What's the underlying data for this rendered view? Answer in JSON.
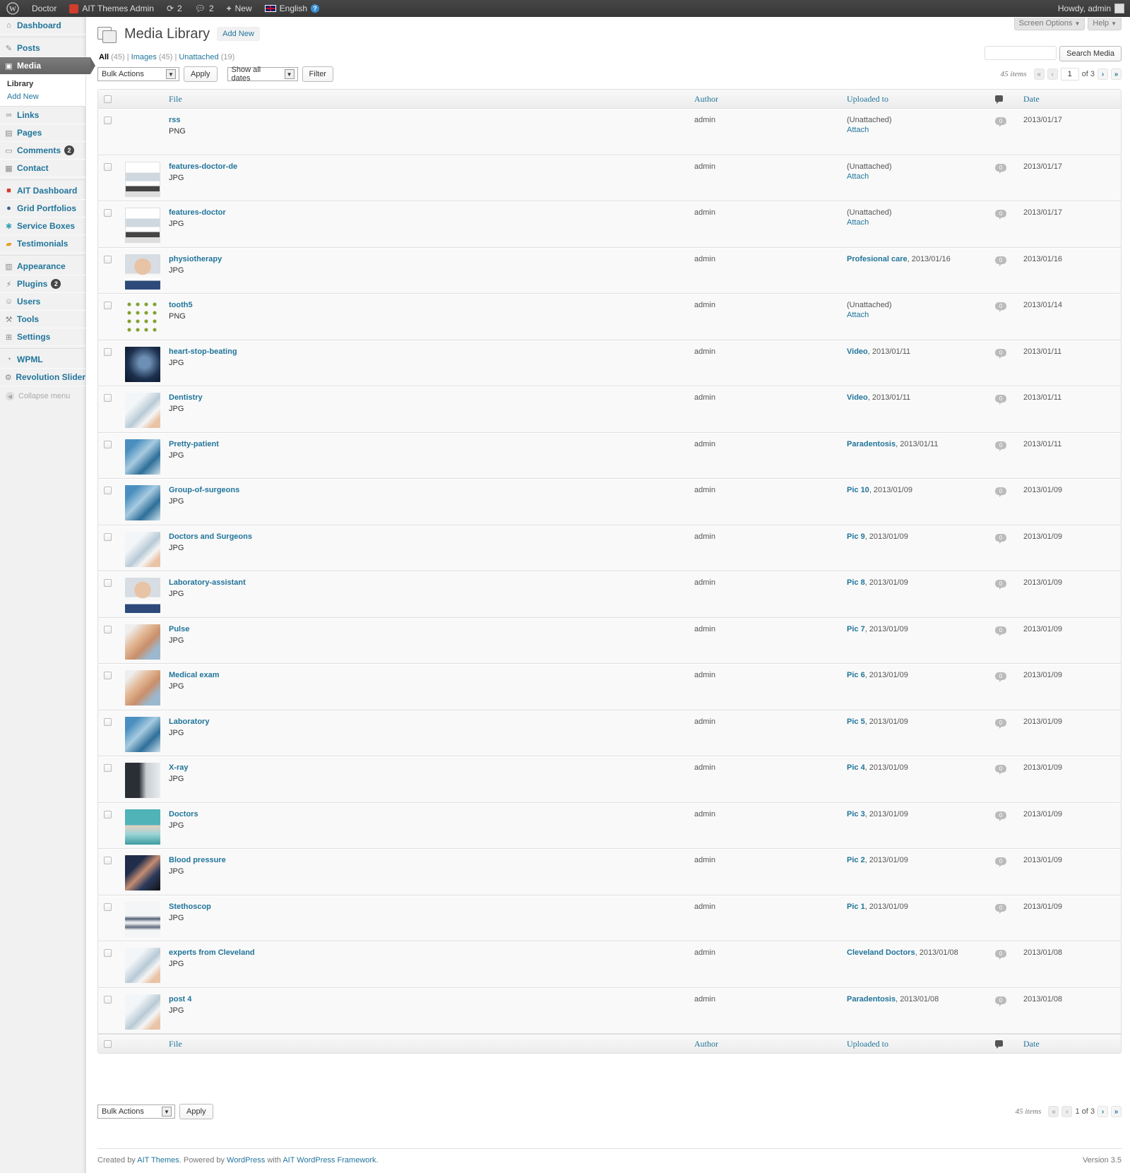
{
  "adminbar": {
    "site_name": "Doctor",
    "ait_label": "AIT Themes Admin",
    "updates_count": "2",
    "comments_count": "2",
    "new_label": "New",
    "language": "English",
    "howdy": "Howdy, admin"
  },
  "sidebar": {
    "dashboard": "Dashboard",
    "posts": "Posts",
    "media": "Media",
    "library": "Library",
    "add_new": "Add New",
    "links": "Links",
    "pages": "Pages",
    "comments": "Comments",
    "comments_badge": "2",
    "contact": "Contact",
    "ait_dashboard": "AIT Dashboard",
    "grid_portfolios": "Grid Portfolios",
    "service_boxes": "Service Boxes",
    "testimonials": "Testimonials",
    "appearance": "Appearance",
    "plugins": "Plugins",
    "plugins_badge": "2",
    "users": "Users",
    "tools": "Tools",
    "settings": "Settings",
    "wpml": "WPML",
    "revolution_slider": "Revolution Slider",
    "collapse": "Collapse menu"
  },
  "header": {
    "screen_options": "Screen Options",
    "help": "Help",
    "title": "Media Library",
    "add_new": "Add New"
  },
  "filters": {
    "all": "All",
    "all_count": "(45)",
    "images": "Images",
    "images_count": "(45)",
    "unattached": "Unattached",
    "unattached_count": "(19)",
    "sep": "|"
  },
  "search": {
    "button": "Search Media",
    "value": ""
  },
  "tablenav": {
    "bulk_actions": "Bulk Actions",
    "apply": "Apply",
    "dates": "Show all dates",
    "filter": "Filter",
    "items": "45 items",
    "current_page": "1",
    "of_pages": "of 3",
    "bottom_pages": "1 of 3"
  },
  "columns": {
    "file": "File",
    "author": "Author",
    "uploaded_to": "Uploaded to",
    "date": "Date"
  },
  "rows": [
    {
      "name": "rss",
      "type": "PNG",
      "author": "admin",
      "up_link": "",
      "up_text": "(Unattached)",
      "attach": "Attach",
      "comments": "0",
      "date": "2013/01/17",
      "thumb": "none"
    },
    {
      "name": "features-doctor-de",
      "type": "JPG",
      "author": "admin",
      "up_link": "",
      "up_text": "(Unattached)",
      "attach": "Attach",
      "comments": "0",
      "date": "2013/01/17",
      "thumb": "doc"
    },
    {
      "name": "features-doctor",
      "type": "JPG",
      "author": "admin",
      "up_link": "",
      "up_text": "(Unattached)",
      "attach": "Attach",
      "comments": "0",
      "date": "2013/01/17",
      "thumb": "doc"
    },
    {
      "name": "physiotherapy",
      "type": "JPG",
      "author": "admin",
      "up_link": "Profesional care",
      "up_text": ", 2013/01/16",
      "attach": "",
      "comments": "0",
      "date": "2013/01/16",
      "thumb": "face"
    },
    {
      "name": "tooth5",
      "type": "PNG",
      "author": "admin",
      "up_link": "",
      "up_text": "(Unattached)",
      "attach": "Attach",
      "comments": "0",
      "date": "2013/01/14",
      "thumb": "dots"
    },
    {
      "name": "heart-stop-beating",
      "type": "JPG",
      "author": "admin",
      "up_link": "Video",
      "up_text": ", 2013/01/11",
      "attach": "",
      "comments": "0",
      "date": "2013/01/11",
      "thumb": "dark"
    },
    {
      "name": "Dentistry",
      "type": "JPG",
      "author": "admin",
      "up_link": "Video",
      "up_text": ", 2013/01/11",
      "attach": "",
      "comments": "0",
      "date": "2013/01/11",
      "thumb": "light"
    },
    {
      "name": "Pretty-patient",
      "type": "JPG",
      "author": "admin",
      "up_link": "Paradentosis",
      "up_text": ", 2013/01/11",
      "attach": "",
      "comments": "0",
      "date": "2013/01/11",
      "thumb": "blue"
    },
    {
      "name": "Group-of-surgeons",
      "type": "JPG",
      "author": "admin",
      "up_link": "Pic 10",
      "up_text": ", 2013/01/09",
      "attach": "",
      "comments": "0",
      "date": "2013/01/09",
      "thumb": "blue"
    },
    {
      "name": "Doctors and Surgeons",
      "type": "JPG",
      "author": "admin",
      "up_link": "Pic 9",
      "up_text": ", 2013/01/09",
      "attach": "",
      "comments": "0",
      "date": "2013/01/09",
      "thumb": "light"
    },
    {
      "name": "Laboratory-assistant",
      "type": "JPG",
      "author": "admin",
      "up_link": "Pic 8",
      "up_text": ", 2013/01/09",
      "attach": "",
      "comments": "0",
      "date": "2013/01/09",
      "thumb": "face"
    },
    {
      "name": "Pulse",
      "type": "JPG",
      "author": "admin",
      "up_link": "Pic 7",
      "up_text": ", 2013/01/09",
      "attach": "",
      "comments": "0",
      "date": "2013/01/09",
      "thumb": "skin"
    },
    {
      "name": "Medical exam",
      "type": "JPG",
      "author": "admin",
      "up_link": "Pic 6",
      "up_text": ", 2013/01/09",
      "attach": "",
      "comments": "0",
      "date": "2013/01/09",
      "thumb": "skin"
    },
    {
      "name": "Laboratory",
      "type": "JPG",
      "author": "admin",
      "up_link": "Pic 5",
      "up_text": ", 2013/01/09",
      "attach": "",
      "comments": "0",
      "date": "2013/01/09",
      "thumb": "blue"
    },
    {
      "name": "X-ray",
      "type": "JPG",
      "author": "admin",
      "up_link": "Pic 4",
      "up_text": ", 2013/01/09",
      "attach": "",
      "comments": "0",
      "date": "2013/01/09",
      "thumb": "gray"
    },
    {
      "name": "Doctors",
      "type": "JPG",
      "author": "admin",
      "up_link": "Pic 3",
      "up_text": ", 2013/01/09",
      "attach": "",
      "comments": "0",
      "date": "2013/01/09",
      "thumb": "teal"
    },
    {
      "name": "Blood pressure",
      "type": "JPG",
      "author": "admin",
      "up_link": "Pic 2",
      "up_text": ", 2013/01/09",
      "attach": "",
      "comments": "0",
      "date": "2013/01/09",
      "thumb": "navy"
    },
    {
      "name": "Stethoscop",
      "type": "JPG",
      "author": "admin",
      "up_link": "Pic 1",
      "up_text": ", 2013/01/09",
      "attach": "",
      "comments": "0",
      "date": "2013/01/09",
      "thumb": "steth"
    },
    {
      "name": "experts from Cleveland",
      "type": "JPG",
      "author": "admin",
      "up_link": "Cleveland Doctors",
      "up_text": ", 2013/01/08",
      "attach": "",
      "comments": "0",
      "date": "2013/01/08",
      "thumb": "light"
    },
    {
      "name": "post 4",
      "type": "JPG",
      "author": "admin",
      "up_link": "Paradentosis",
      "up_text": ", 2013/01/08",
      "attach": "",
      "comments": "0",
      "date": "2013/01/08",
      "thumb": "light"
    }
  ],
  "footer": {
    "created_by": "Created by",
    "ait_themes": "AIT Themes",
    "powered_by": ". Powered by",
    "wordpress": "WordPress",
    "with": "with",
    "framework": "AIT WordPress Framework",
    "period": ".",
    "version": "Version 3.5"
  },
  "colors": {
    "link": "#21759b",
    "adminbar": "#464646",
    "menu_current": "#6d6d6d"
  }
}
